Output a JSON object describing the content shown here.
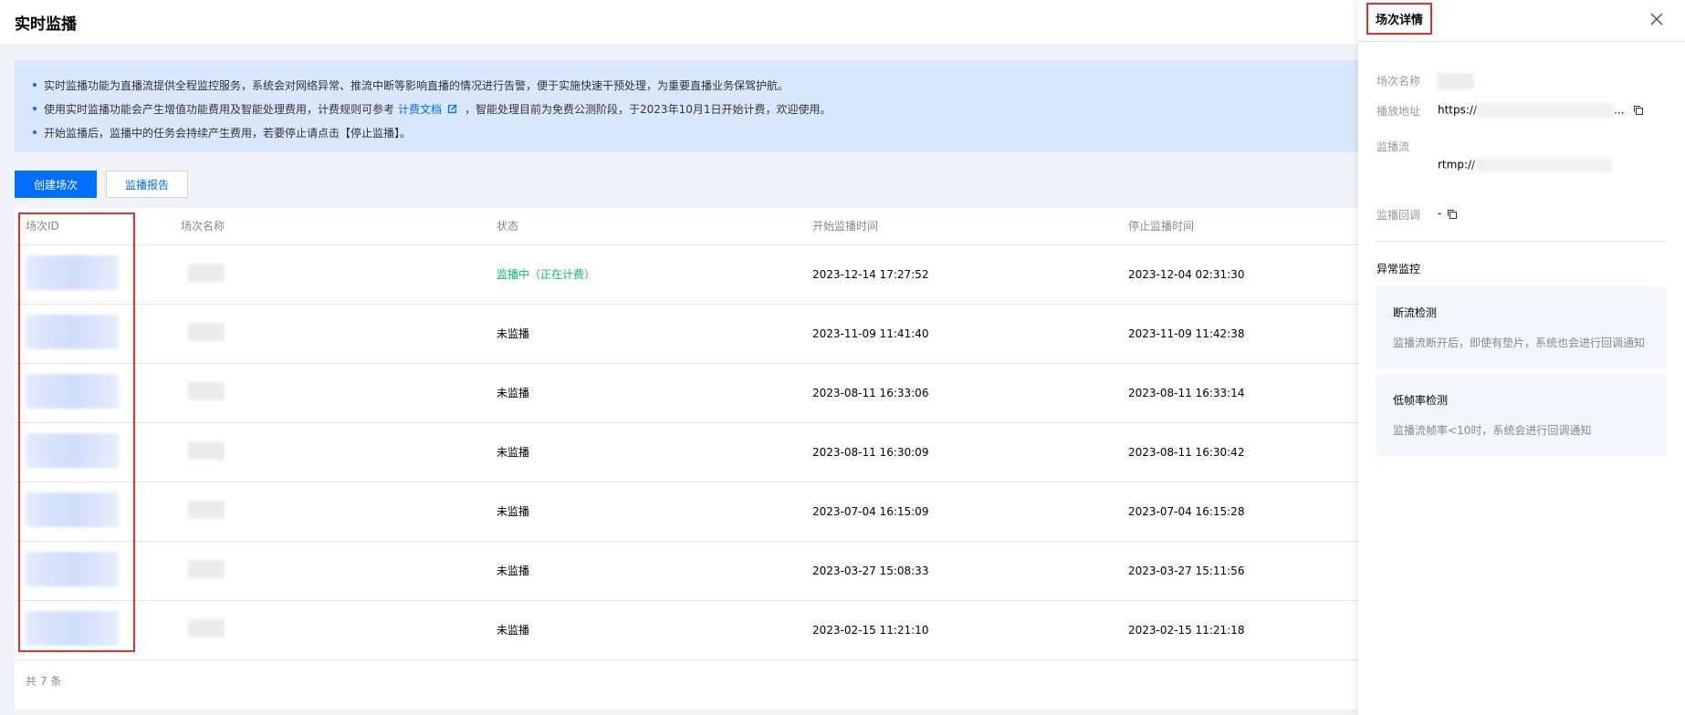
{
  "page": {
    "title": "实时监播"
  },
  "notice": {
    "line1": "实时监播功能为直播流提供全程监控服务，系统会对网络异常、推流中断等影响直播的情况进行告警，便于实施快速干预处理，为重要直播业务保驾护航。",
    "line2_pre": "使用实时监播功能会产生增值功能费用及智能处理费用，计费规则可参考",
    "line2_link": "计费文档",
    "line2_post": "，智能处理目前为免费公测阶段，于2023年10月1日开始计费，欢迎使用。",
    "line3": "开始监播后，监播中的任务会持续产生费用，若要停止请点击【停止监播】。"
  },
  "toolbar": {
    "create_label": "创建场次",
    "report_label": "监播报告"
  },
  "table": {
    "headers": {
      "id": "场次ID",
      "name": "场次名称",
      "status": "状态",
      "start": "开始监播时间",
      "stop": "停止监播时间"
    },
    "rows": [
      {
        "status": "监播中（正在计费）",
        "running": true,
        "start": "2023-12-14 17:27:52",
        "stop": "2023-12-04 02:31:30"
      },
      {
        "status": "未监播",
        "running": false,
        "start": "2023-11-09 11:41:40",
        "stop": "2023-11-09 11:42:38"
      },
      {
        "status": "未监播",
        "running": false,
        "start": "2023-08-11 16:33:06",
        "stop": "2023-08-11 16:33:14"
      },
      {
        "status": "未监播",
        "running": false,
        "start": "2023-08-11 16:30:09",
        "stop": "2023-08-11 16:30:42"
      },
      {
        "status": "未监播",
        "running": false,
        "start": "2023-07-04 16:15:09",
        "stop": "2023-07-04 16:15:28"
      },
      {
        "status": "未监播",
        "running": false,
        "start": "2023-03-27 15:08:33",
        "stop": "2023-03-27 15:11:56"
      },
      {
        "status": "未监播",
        "running": false,
        "start": "2023-02-15 11:21:10",
        "stop": "2023-02-15 11:21:18"
      }
    ],
    "total_label": "共 7 条"
  },
  "drawer": {
    "title": "场次详情",
    "name_label": "场次名称",
    "play_label": "播放地址",
    "play_value": "https://",
    "play_ellipsis": "...",
    "stream_label": "监播流",
    "stream_value": "rtmp://",
    "callback_label": "监播回调",
    "callback_value": "-",
    "section_title": "异常监控",
    "card1_title": "断流检测",
    "card1_desc": "监播流断开后，即使有垫片，系统也会进行回调通知",
    "card2_title": "低帧率检测",
    "card2_desc": "监播流帧率<10时，系统会进行回调通知"
  },
  "colors": {
    "primary": "#006eff",
    "running": "#0abf5b",
    "highlight": "#e0302c",
    "notice_bg": "#d9e7fd"
  }
}
